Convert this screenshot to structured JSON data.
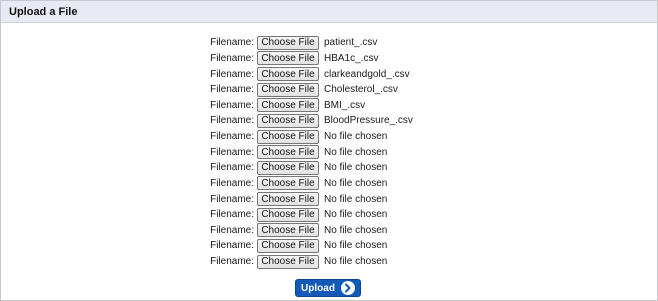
{
  "panel": {
    "title": "Upload a File"
  },
  "file_rows": [
    {
      "label": "Filename:",
      "button": "Choose File",
      "file": "patient_.csv"
    },
    {
      "label": "Filename:",
      "button": "Choose File",
      "file": "HBA1c_.csv"
    },
    {
      "label": "Filename:",
      "button": "Choose File",
      "file": "clarkeandgold_.csv"
    },
    {
      "label": "Filename:",
      "button": "Choose File",
      "file": "Cholesterol_.csv"
    },
    {
      "label": "Filename:",
      "button": "Choose File",
      "file": "BMI_.csv"
    },
    {
      "label": "Filename:",
      "button": "Choose File",
      "file": "BloodPressure_.csv"
    },
    {
      "label": "Filename:",
      "button": "Choose File",
      "file": "No file chosen"
    },
    {
      "label": "Filename:",
      "button": "Choose File",
      "file": "No file chosen"
    },
    {
      "label": "Filename:",
      "button": "Choose File",
      "file": "No file chosen"
    },
    {
      "label": "Filename:",
      "button": "Choose File",
      "file": "No file chosen"
    },
    {
      "label": "Filename:",
      "button": "Choose File",
      "file": "No file chosen"
    },
    {
      "label": "Filename:",
      "button": "Choose File",
      "file": "No file chosen"
    },
    {
      "label": "Filename:",
      "button": "Choose File",
      "file": "No file chosen"
    },
    {
      "label": "Filename:",
      "button": "Choose File",
      "file": "No file chosen"
    },
    {
      "label": "Filename:",
      "button": "Choose File",
      "file": "No file chosen"
    }
  ],
  "upload": {
    "label": "Upload",
    "icon": "arrow-right-circle-icon",
    "color": "#1359b7"
  }
}
